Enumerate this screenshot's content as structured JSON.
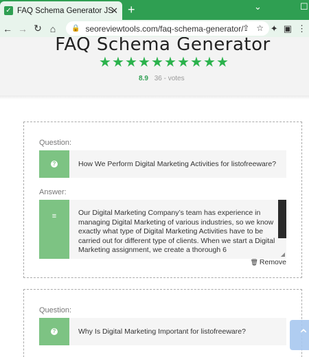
{
  "browser": {
    "tab_title": "FAQ Schema Generator JSON-LD",
    "tab_close": "✕",
    "new_tab": "+",
    "url": "seoreviewtools.com/faq-schema-generator/",
    "icons": [
      "back-icon",
      "forward-icon",
      "reload-icon",
      "home-icon",
      "lock-icon",
      "share-icon",
      "bookmark-star-icon",
      "extensions-icon",
      "sidebar-icon",
      "menu-icon"
    ]
  },
  "page": {
    "title": "FAQ Schema Generator",
    "rating_score": "8.9",
    "rating_votes": "36 - votes",
    "stars_count": 10,
    "accent_color": "#2bb24c"
  },
  "faq": [
    {
      "question_label": "Question:",
      "question": "How We Perform Digital Marketing Activities for listofreeware?",
      "answer_label": "Answer:",
      "answer": "Our Digital Marketing Company’s team has experience in managing Digital Marketing of various industries, so we know exactly what type of Digital Marketing Activities have to be carried out for different type of clients. When we start a Digital Marketing assignment, we create a thorough 6",
      "remove_label": "Remove"
    },
    {
      "question_label": "Question:",
      "question": "Why Is Digital Marketing Important for listofreeware?"
    }
  ]
}
